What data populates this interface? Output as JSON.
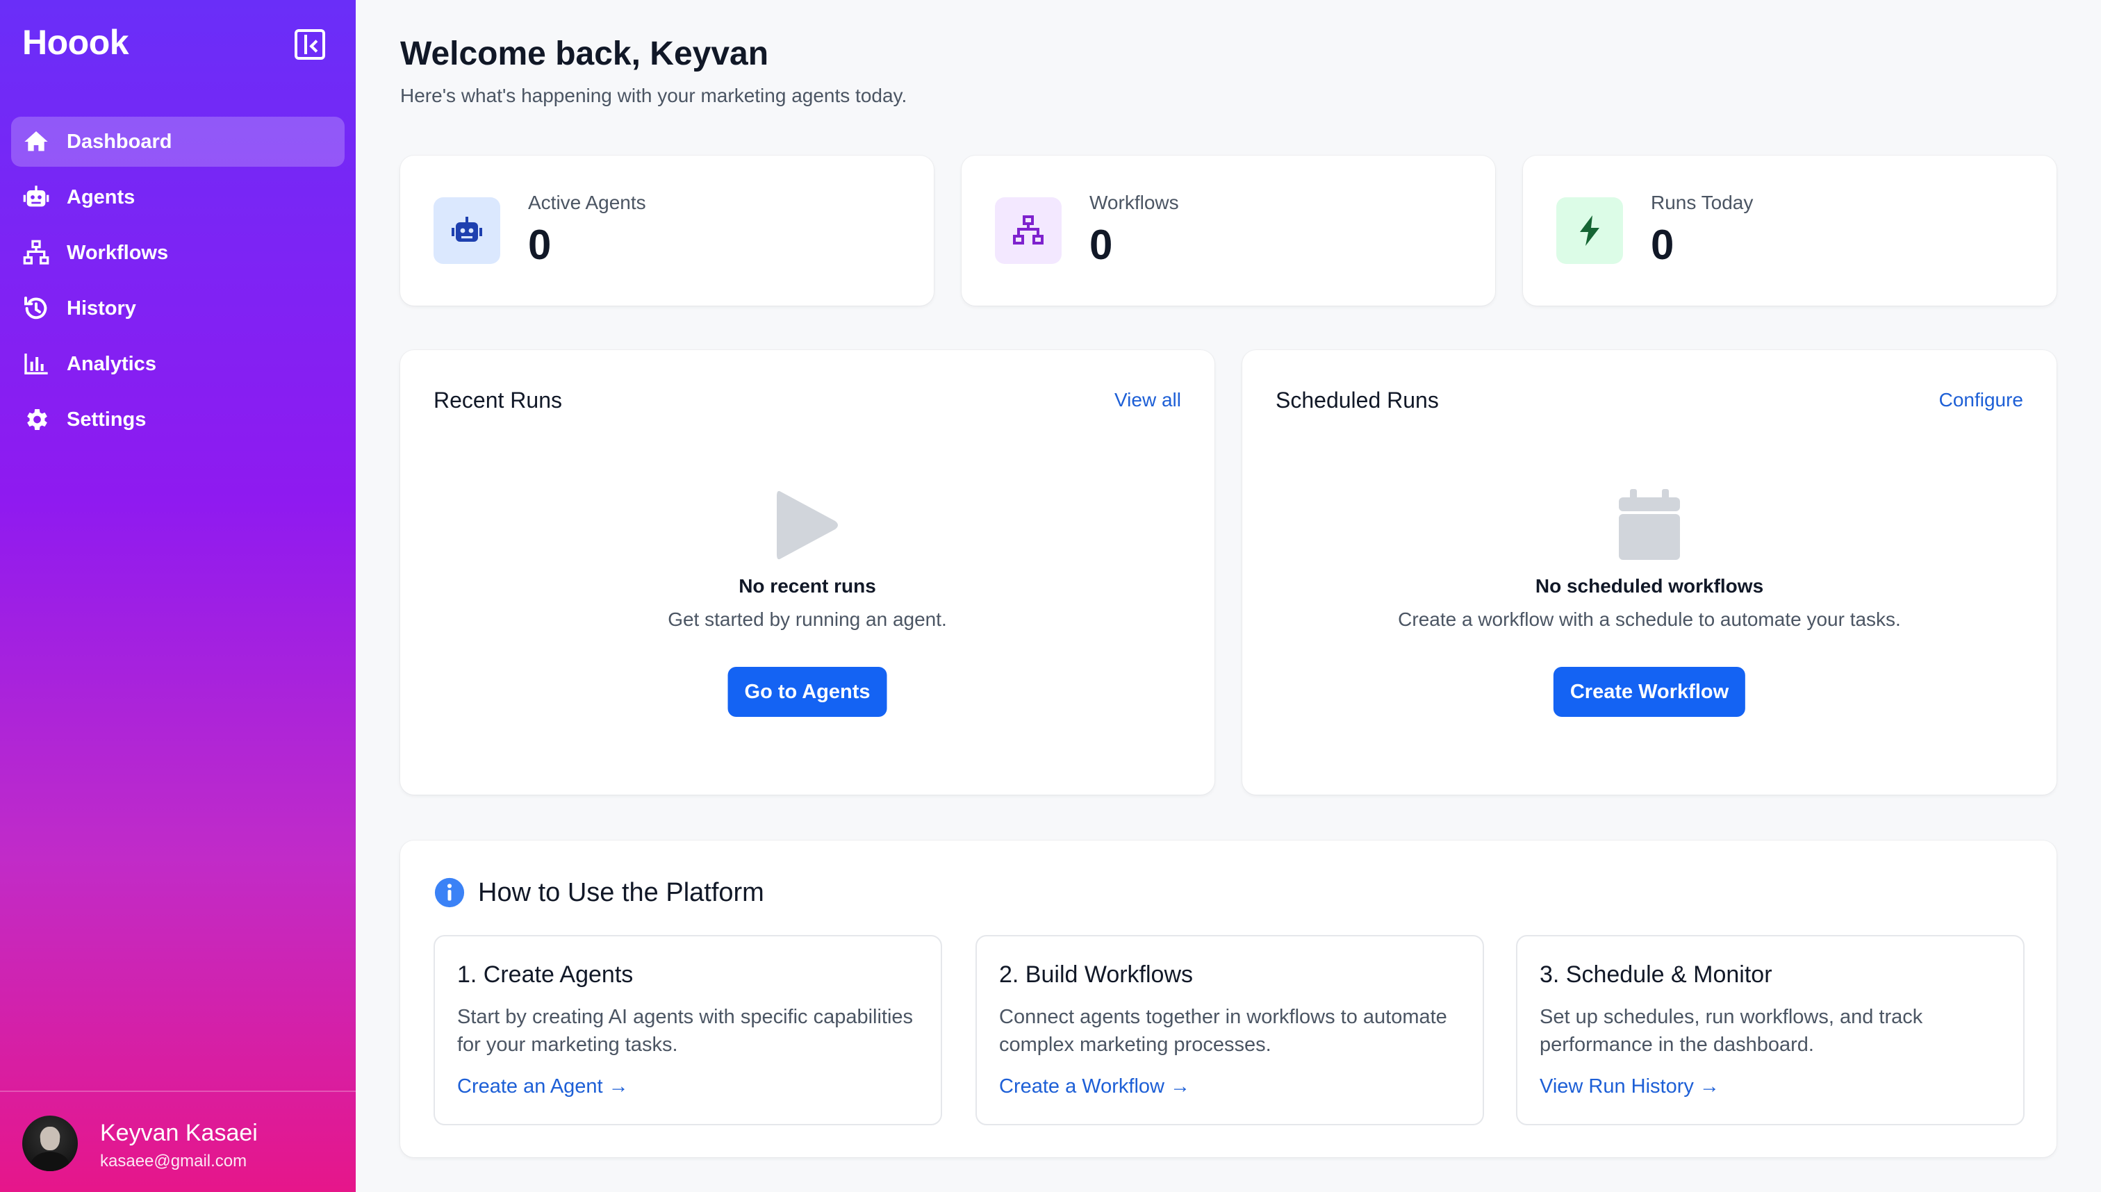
{
  "sidebar": {
    "brand": "Hoook",
    "items": [
      {
        "label": "Dashboard",
        "icon": "home-icon",
        "active": true
      },
      {
        "label": "Agents",
        "icon": "robot-icon"
      },
      {
        "label": "Workflows",
        "icon": "sitemap-icon"
      },
      {
        "label": "History",
        "icon": "history-icon"
      },
      {
        "label": "Analytics",
        "icon": "bar-chart-icon"
      },
      {
        "label": "Settings",
        "icon": "gear-icon"
      }
    ],
    "user": {
      "name": "Keyvan Kasaei",
      "email": "kasaee@gmail.com"
    }
  },
  "header": {
    "title": "Welcome back, Keyvan",
    "subtitle": "Here's what's happening with your marketing agents today."
  },
  "stats": [
    {
      "label": "Active Agents",
      "value": "0",
      "icon": "robot-icon",
      "color": "#1e40af",
      "bg": "#dbe8fe"
    },
    {
      "label": "Workflows",
      "value": "0",
      "icon": "sitemap-icon",
      "color": "#7e22ce",
      "bg": "#f3e8ff"
    },
    {
      "label": "Runs Today",
      "value": "0",
      "icon": "bolt-icon",
      "color": "#166534",
      "bg": "#dcfce7"
    }
  ],
  "recent_runs": {
    "title": "Recent Runs",
    "link": "View all",
    "empty_title": "No recent runs",
    "empty_sub": "Get started by running an agent.",
    "button": "Go to Agents"
  },
  "scheduled_runs": {
    "title": "Scheduled Runs",
    "link": "Configure",
    "empty_title": "No scheduled workflows",
    "empty_sub": "Create a workflow with a schedule to automate your tasks.",
    "button": "Create Workflow"
  },
  "howto": {
    "title": "How to Use the Platform",
    "steps": [
      {
        "title": "1. Create Agents",
        "desc": "Start by creating AI agents with specific capabilities for your marketing tasks.",
        "link": "Create an Agent →"
      },
      {
        "title": "2. Build Workflows",
        "desc": "Connect agents together in workflows to automate complex marketing processes.",
        "link": "Create a Workflow →"
      },
      {
        "title": "3. Schedule & Monitor",
        "desc": "Set up schedules, run workflows, and track performance in the dashboard.",
        "link": "View Run History →"
      }
    ]
  },
  "colors": {
    "accent": "#1463f3",
    "link": "#1d5fd6",
    "sidebar_top": "#6a2ef8",
    "sidebar_bottom": "#e6168a"
  }
}
